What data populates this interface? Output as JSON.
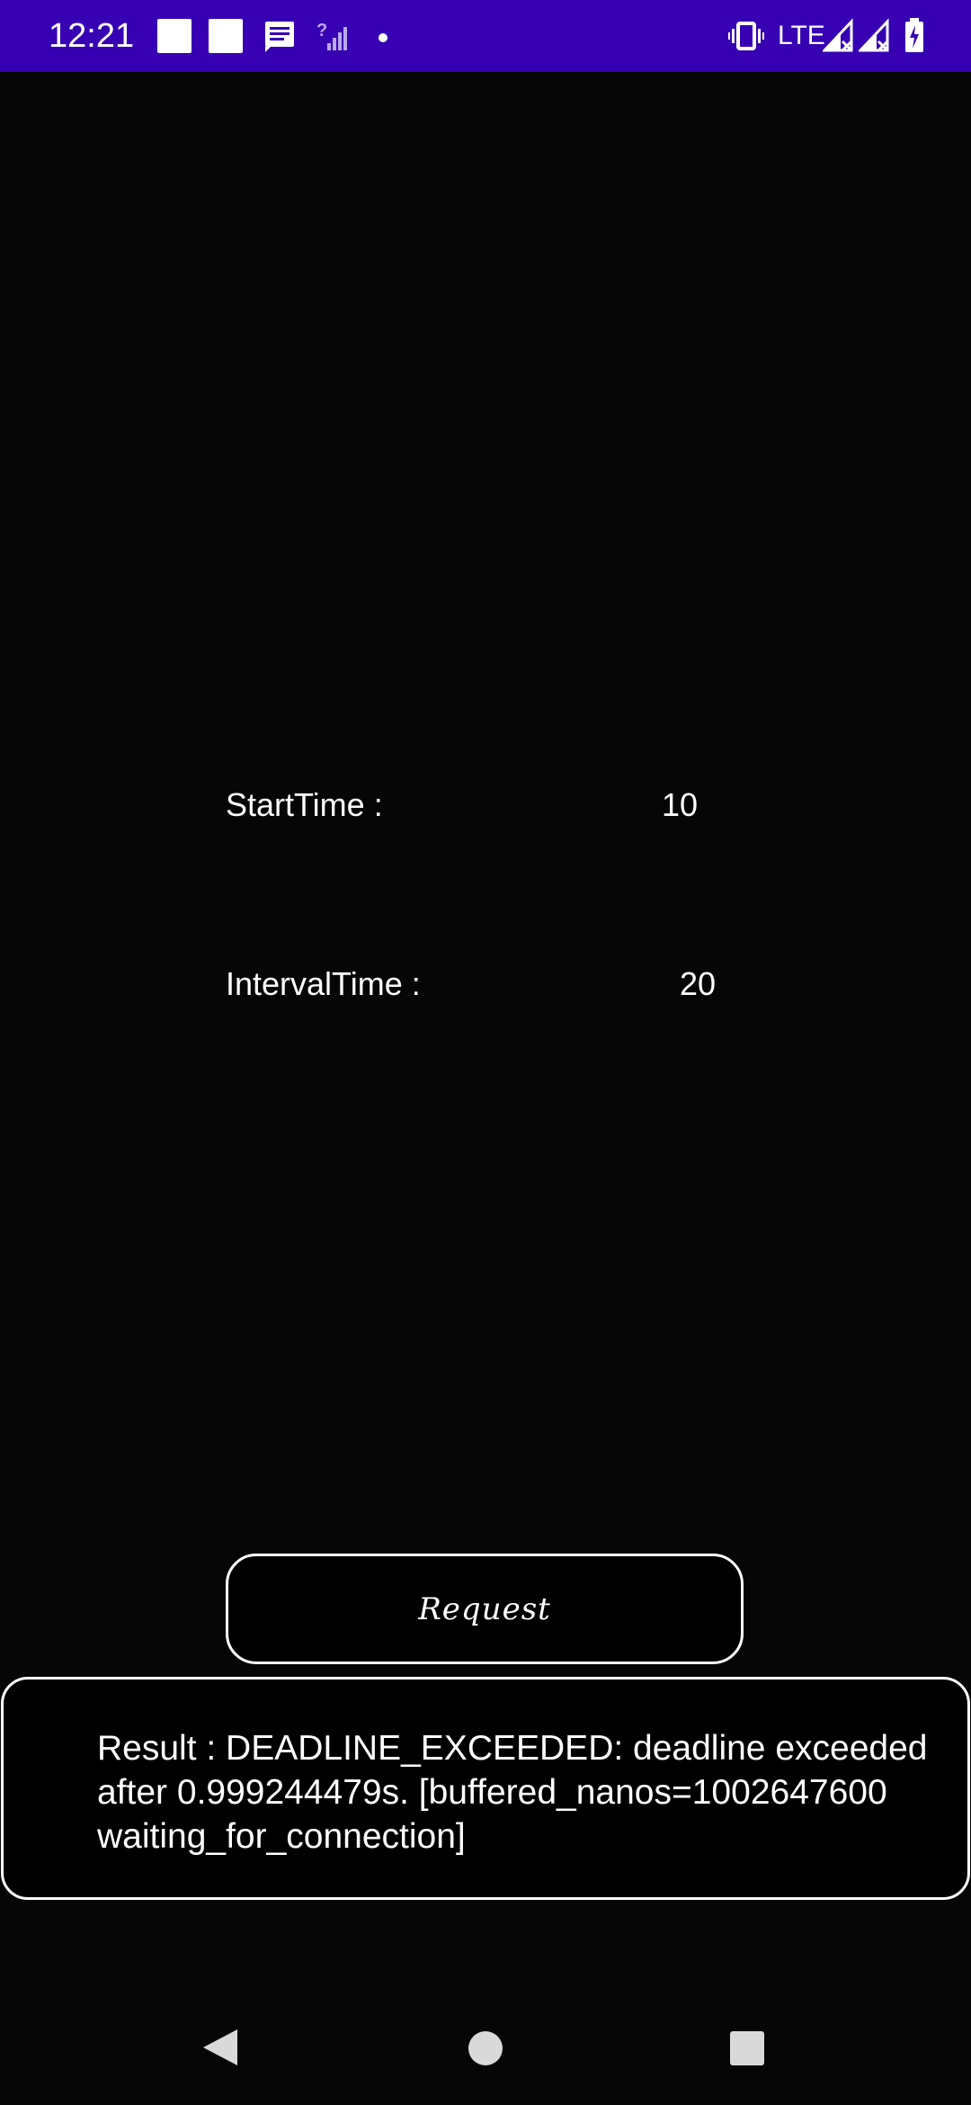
{
  "status_bar": {
    "time": "12:21",
    "network_label": "LTE",
    "icons": [
      "notification-square-icon",
      "notification-square-icon",
      "message-icon",
      "no-signal-icon",
      "dot-icon",
      "vibrate-icon",
      "signal-icon",
      "signal-icon",
      "battery-icon"
    ],
    "background_color": "#3700b3"
  },
  "form": {
    "start_time_label": "StartTime :",
    "start_time_value": "10",
    "interval_time_label": "IntervalTime :",
    "interval_time_value": "20"
  },
  "request_button": {
    "label": "Request"
  },
  "result": {
    "text": "Result : DEADLINE_EXCEEDED: deadline exceeded\nafter 0.999244479s. [buffered_nanos=1002647600\nwaiting_for_connection]"
  },
  "nav_bar": {
    "icons": [
      "back-icon",
      "home-icon",
      "recents-icon"
    ]
  },
  "colors": {
    "background": "#060606",
    "foreground": "#ffffff",
    "status_bar": "#3700b3"
  }
}
